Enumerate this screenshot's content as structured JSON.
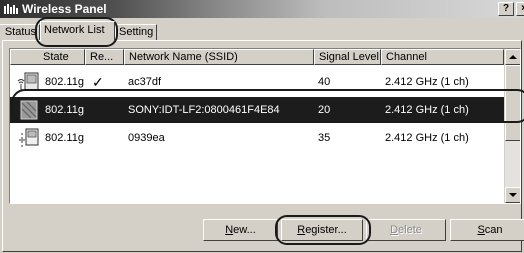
{
  "window": {
    "title": "Wireless Panel",
    "help_button": "?",
    "close_button": "×"
  },
  "tabs": [
    {
      "label": "Status",
      "active": false
    },
    {
      "label": "Network List",
      "active": true
    },
    {
      "label": "Setting",
      "active": false
    }
  ],
  "network_list": {
    "columns": [
      "State",
      "Re...",
      "Network Name (SSID)",
      "Signal Level",
      "Channel"
    ],
    "rows": [
      {
        "state": "802.11g",
        "registered": "✓",
        "ssid": "ac37df",
        "signal": "40",
        "channel": "2.412 GHz (1 ch)",
        "selected": false
      },
      {
        "state": "802.11g",
        "registered": "",
        "ssid": "SONY:IDT-LF2:0800461F4E84",
        "signal": "20",
        "channel": "2.412 GHz (1 ch)",
        "selected": true
      },
      {
        "state": "802.11g",
        "registered": "",
        "ssid": "0939ea",
        "signal": "35",
        "channel": "2.412 GHz (1 ch)",
        "selected": false
      }
    ]
  },
  "buttons": {
    "new": {
      "text": "ew...",
      "accel": "N"
    },
    "register": {
      "text": "egister...",
      "accel": "R"
    },
    "delete": {
      "text": "elete",
      "accel": "D"
    },
    "scan": {
      "text": "can",
      "accel": "S"
    }
  },
  "colors": {
    "selection": "#1c1c1c",
    "face": "#d4d0c8",
    "callout": "#1a1a1a"
  }
}
